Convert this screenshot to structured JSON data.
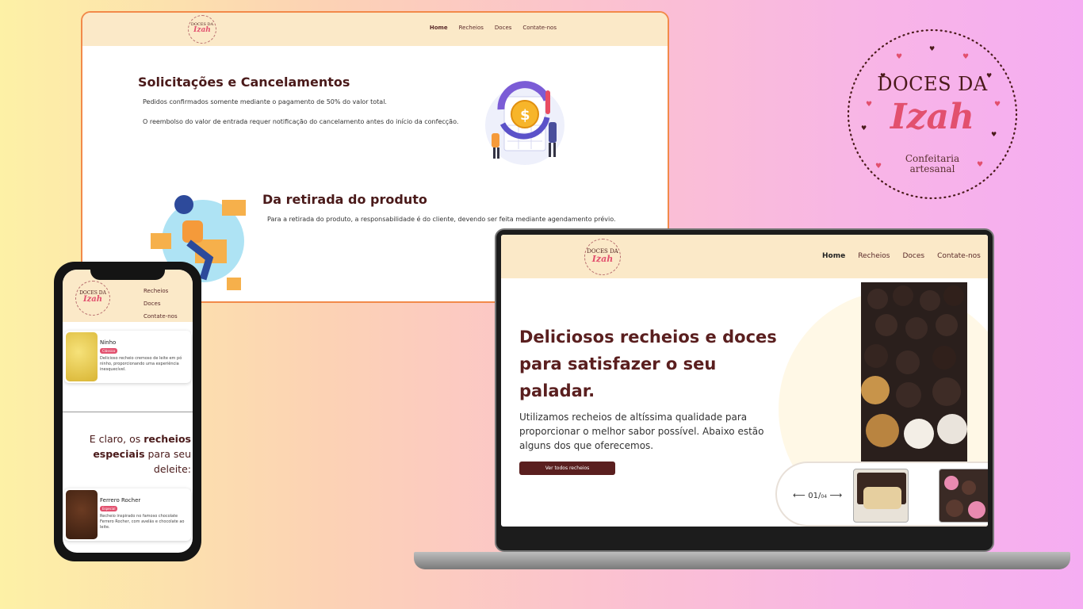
{
  "brand": {
    "line1": "DOCES DA",
    "line2": "Izah",
    "line3": "Confeitaria",
    "line4": "artesanal"
  },
  "desktop_page": {
    "nav": [
      "Home",
      "Recheios",
      "Doces",
      "Contate-nos"
    ],
    "section1_title": "Solicitações e Cancelamentos",
    "section1_p1": "Pedidos confirmados somente mediante o pagamento de 50% do valor total.",
    "section1_p2": "O reembolso do valor de entrada requer notificação do cancelamento antes do início da confecção.",
    "section2_title": "Da retirada do produto",
    "section2_p1": "Para a retirada do produto, a responsabilidade é do cliente, devendo ser feita mediante agendamento prévio."
  },
  "laptop_page": {
    "nav": [
      "Home",
      "Recheios",
      "Doces",
      "Contate-nos"
    ],
    "hero_title": "Deliciosos recheios e doces para satisfazer o seu paladar.",
    "hero_text": "Utilizamos recheios de altíssima qualidade para proporcionar o melhor sabor possível. Abaixo estão alguns dos que oferecemos.",
    "hero_button": "Ver todos recheios",
    "slider_counter": "01/",
    "slider_total": "04",
    "arrow_left": "⟵",
    "arrow_right": "⟶"
  },
  "phone_page": {
    "menu": [
      "Recheios",
      "Doces",
      "Contate-nos"
    ],
    "card1": {
      "name": "Ninho",
      "badge": "Clássico",
      "desc": "Delicioso recheio cremoso de leite em pó ninho, proporcionando uma experiência inesquecível."
    },
    "subtitle_pre": "E claro, os",
    "subtitle_bold": "recheios especiais",
    "subtitle_post": "para seu deleite:",
    "card2": {
      "name": "Ferrero Rocher",
      "badge": "Especial",
      "desc": "Recheio inspirado no famoso chocolate Ferrero Rocher, com avelãs e chocolate ao leite."
    }
  },
  "colors": {
    "accent": "#5a1f1f",
    "pink": "#e2506e",
    "nav_bg": "#fbe9c8"
  }
}
